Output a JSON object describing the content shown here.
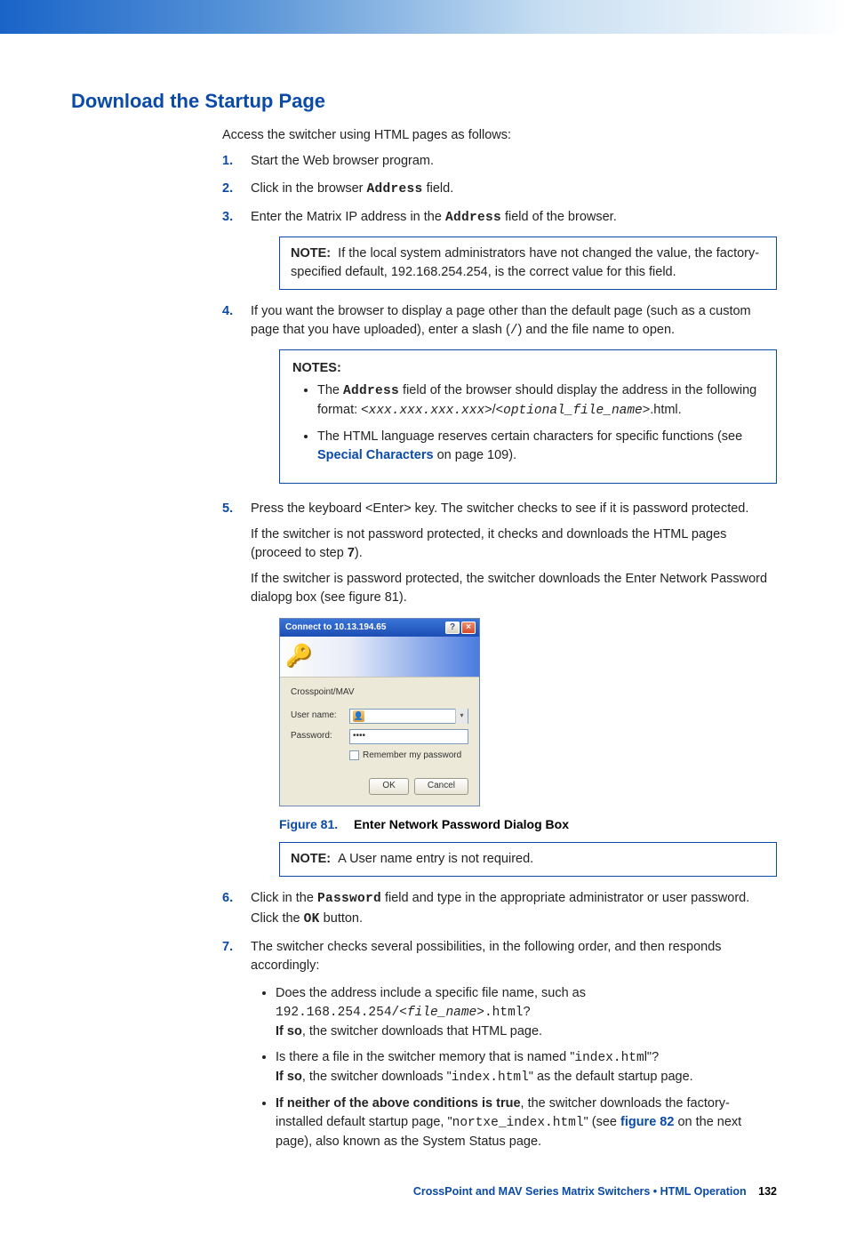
{
  "heading": "Download the Startup Page",
  "intro": "Access the switcher using HTML pages as follows:",
  "step1": {
    "num": "1.",
    "text": "Start the Web browser program."
  },
  "step2": {
    "num": "2.",
    "prefix": "Click in the browser ",
    "address": "Address",
    "suffix": " field."
  },
  "step3": {
    "num": "3.",
    "prefix": "Enter the Matrix IP address in the ",
    "address": "Address",
    "suffix": " field of the browser."
  },
  "note1": {
    "label": "NOTE:",
    "text": "If the local system administrators have not changed the value, the factory-specified default, 192.168.254.254, is the correct value for this field."
  },
  "step4": {
    "num": "4.",
    "p1a": "If you want the browser to display a page other than the default page (such as a custom page that you have uploaded), enter a slash (",
    "slash": "/",
    "p1b": ") and the file name to open."
  },
  "notes2": {
    "label": "NOTES:",
    "b1a": "The ",
    "b1addr": "Address",
    "b1b": " field of the browser should display the address in the following format: <",
    "b1fmt1": "xxx.xxx.xxx.xxx",
    "b1c": ">/<",
    "b1fmt2": "optional_file_name",
    "b1d": ">.html.",
    "b2a": "The HTML language reserves certain characters for specific functions (see ",
    "b2link": "Special Characters",
    "b2b": " on page 109)."
  },
  "step5": {
    "num": "5.",
    "p1": "Press the keyboard <Enter> key. The switcher checks to see if it is password protected.",
    "p2a": "If the switcher is not password protected, it checks and downloads the HTML pages (proceed to step ",
    "p2bold": "7",
    "p2b": ").",
    "p3": "If the switcher is password protected, the switcher downloads the Enter Network Password dialopg box (see figure 81)."
  },
  "dialog": {
    "title": "Connect to 10.13.194.65",
    "realm": "Crosspoint/MAV",
    "user_label": "User name:",
    "user_value": "",
    "pass_label": "Password:",
    "pass_value": "••••",
    "remember": "Remember my password",
    "ok": "OK",
    "cancel": "Cancel"
  },
  "fig81": {
    "num": "Figure 81.",
    "title": "Enter Network Password Dialog Box"
  },
  "note3": {
    "label": "NOTE:",
    "text": "A User name entry is not required."
  },
  "step6": {
    "num": "6.",
    "a": "Click in the ",
    "pwfield": "Password",
    "b": " field and type in the appropriate administrator or user password. Click the ",
    "ok": "OK",
    "c": " button."
  },
  "step7": {
    "num": "7.",
    "intro": "The switcher checks several possibilities, in the following order, and then responds accordingly:",
    "b1a": "Does the address include a specific file name, such as ",
    "b1code": "192.168.254.254/<",
    "b1codeit": "file_name",
    "b1code2": ">.html",
    "b1q": "?",
    "b1ifso": "If so",
    "b1rest": ", the switcher downloads that HTML page.",
    "b2a": "Is there a file in the switcher memory that is named \"",
    "b2code": "index.htm",
    "b2a2": "l\"?",
    "b2ifso": "If so",
    "b2rest1": ", the switcher downloads \"",
    "b2code2": "index.html",
    "b2rest2": "\" as the default startup page.",
    "b3bold": "If neither of the above conditions is true",
    "b3a": ", the switcher downloads the factory-installed default startup page, \"",
    "b3code": "nortxe_index.html",
    "b3b": "\" (see ",
    "b3link": "figure 82",
    "b3c": " on the next page), also known as the System Status page."
  },
  "footer": {
    "blue": "CrossPoint and MAV Series Matrix Switchers • HTML Operation",
    "page": "132"
  }
}
